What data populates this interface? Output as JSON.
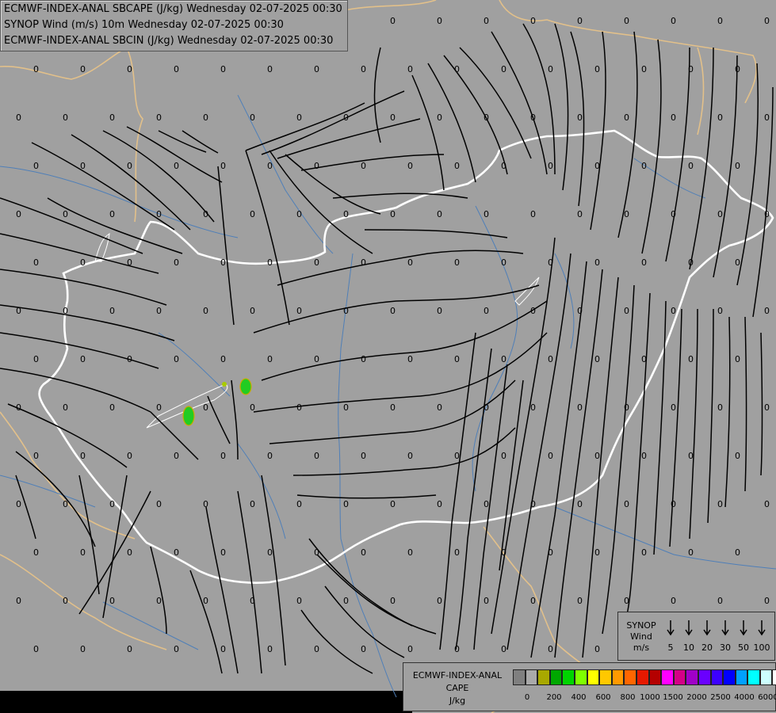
{
  "header": {
    "lines": [
      "ECMWF-INDEX-ANAL SBCAPE (J/kg) Wednesday 02-07-2025 00:30",
      "SYNOP Wind (m/s) 10m Wednesday 02-07-2025 00:30",
      "ECMWF-INDEX-ANAL SBCIN (J/kg) Wednesday 02-07-2025 00:30"
    ]
  },
  "map": {
    "background_color": "#a0a0a0",
    "border_colors": {
      "hungary": "#ffffff",
      "neighbours": "#e2c08a",
      "rivers": "#4f7fb8",
      "streamlines": "#000000",
      "cape_patch": "#22cc22"
    },
    "value_label": "0"
  },
  "wind_legend": {
    "title": [
      "SYNOP",
      "Wind",
      "m/s"
    ],
    "speeds": [
      "5",
      "10",
      "20",
      "30",
      "50",
      "100"
    ]
  },
  "cape_legend": {
    "title": [
      "ECMWF-INDEX-ANAL",
      "CAPE",
      "J/kg"
    ],
    "colors": [
      "#7f7f7f",
      "#a9a9a9",
      "#a8a800",
      "#00a800",
      "#00d400",
      "#7fff00",
      "#ffff00",
      "#ffc800",
      "#ff9900",
      "#ff6600",
      "#e61900",
      "#b40000",
      "#ff00ff",
      "#d40087",
      "#a000c8",
      "#6a00ff",
      "#3c00ff",
      "#0000ff",
      "#00a0ff",
      "#00ffff",
      "#ccffff",
      "#ffffff"
    ],
    "tick_labels": [
      "0",
      "200",
      "400",
      "600",
      "800",
      "1000",
      "1500",
      "2000",
      "2500",
      "4000",
      "6000"
    ]
  }
}
